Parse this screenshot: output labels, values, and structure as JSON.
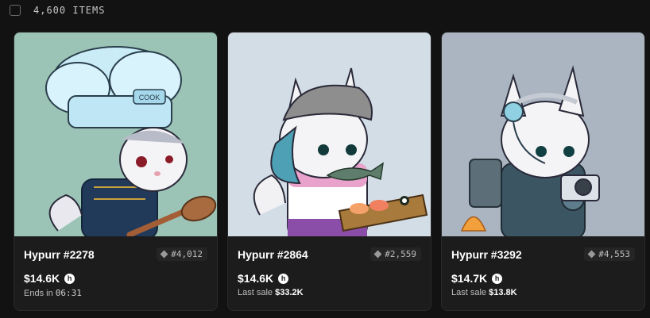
{
  "header": {
    "items_count": "4,600 ITEMS"
  },
  "cards": [
    {
      "name": "Hypurr #2278",
      "rank": "#4,012",
      "price": "$14.6K",
      "sub_prefix": "Ends in",
      "sub_value": "06:31",
      "art_bg": "#9cc4b6",
      "hat_text": "COOK"
    },
    {
      "name": "Hypurr #2864",
      "rank": "#2,559",
      "price": "$14.6K",
      "sub_prefix": "Last sale",
      "sub_value": "$33.2K",
      "art_bg": "#d3dde6"
    },
    {
      "name": "Hypurr #3292",
      "rank": "#4,553",
      "price": "$14.7K",
      "sub_prefix": "Last sale",
      "sub_value": "$13.8K",
      "art_bg": "#aab5c1"
    }
  ],
  "icons": {
    "currency": "h-coin-icon",
    "rank": "diamond-icon"
  }
}
